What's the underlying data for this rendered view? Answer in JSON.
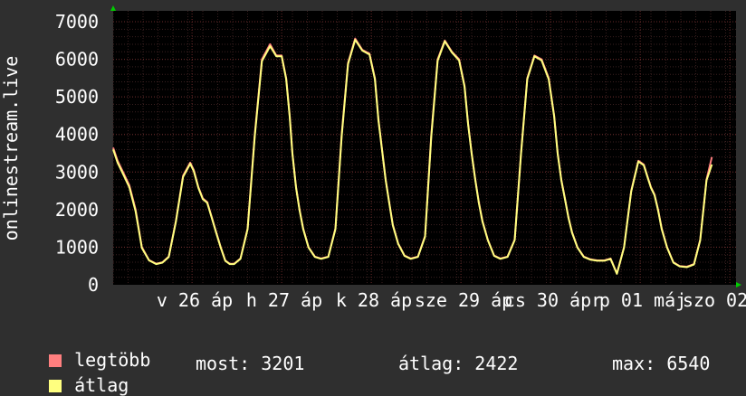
{
  "chart_data": {
    "type": "line",
    "ylabel": "onlinestream.live",
    "ylim": [
      0,
      7000
    ],
    "yticks": [
      0,
      1000,
      2000,
      3000,
      4000,
      5000,
      6000,
      7000
    ],
    "xticks": [
      "v 26 ápr",
      "h 27 ápr",
      "k 28 ápr",
      "sze 29 ápr",
      "cs 30 ápr",
      "p 01 máj",
      "szo 02"
    ],
    "xtick_labels_rendered": [
      "v 26 áp",
      "h 27 áp",
      "k 28 áp",
      "sze 29 áp",
      "cs 30 ápr",
      "p 01 máj",
      "szo 02"
    ],
    "grid": true,
    "colors": {
      "background": "#2f2f2f",
      "plot": "#000000",
      "grid": "#6a2a2a",
      "legtobb": "#ff7f7f",
      "atlag": "#ffff7f",
      "axis_arrow": "#00cc00"
    },
    "x": [
      0.0,
      0.05,
      0.12,
      0.18,
      0.25,
      0.32,
      0.4,
      0.48,
      0.55,
      0.62,
      0.7,
      0.78,
      0.86,
      0.9,
      0.95,
      1.0,
      1.05,
      1.1,
      1.15,
      1.2,
      1.25,
      1.3,
      1.35,
      1.42,
      1.5,
      1.58,
      1.66,
      1.75,
      1.82,
      1.88,
      1.93,
      1.97,
      2.0,
      2.04,
      2.08,
      2.12,
      2.18,
      2.25,
      2.32,
      2.4,
      2.48,
      2.55,
      2.62,
      2.7,
      2.78,
      2.86,
      2.92,
      2.96,
      3.0,
      3.04,
      3.08,
      3.12,
      3.18,
      3.25,
      3.32,
      3.4,
      3.48,
      3.55,
      3.62,
      3.7,
      3.78,
      3.86,
      3.92,
      3.96,
      4.0,
      4.04,
      4.08,
      4.12,
      4.18,
      4.25,
      4.32,
      4.4,
      4.48,
      4.55,
      4.62,
      4.7,
      4.78,
      4.86,
      4.92,
      4.96,
      5.0,
      5.04,
      5.08,
      5.12,
      5.18,
      5.25,
      5.32,
      5.4,
      5.48,
      5.55,
      5.62,
      5.7,
      5.78,
      5.86,
      5.92,
      5.96,
      6.0,
      6.04,
      6.08,
      6.12,
      6.18,
      6.25,
      6.32,
      6.4,
      6.48,
      6.55,
      6.62,
      6.68
    ],
    "series": [
      {
        "name": "legtöbb",
        "values": [
          3650,
          3300,
          2950,
          2650,
          2000,
          1000,
          660,
          560,
          600,
          750,
          1700,
          2900,
          3250,
          3050,
          2600,
          2300,
          2200,
          1800,
          1400,
          1000,
          650,
          560,
          560,
          700,
          1500,
          4000,
          6000,
          6400,
          6100,
          6100,
          5500,
          4500,
          3500,
          2600,
          2000,
          1500,
          1000,
          750,
          700,
          750,
          1500,
          4000,
          5900,
          6550,
          6250,
          6150,
          5500,
          4400,
          3600,
          2800,
          2200,
          1600,
          1100,
          780,
          700,
          750,
          1300,
          4000,
          6000,
          6500,
          6200,
          6000,
          5300,
          4300,
          3500,
          2800,
          2200,
          1700,
          1200,
          780,
          700,
          750,
          1200,
          3500,
          5500,
          6100,
          6000,
          5500,
          4500,
          3500,
          2800,
          2300,
          1800,
          1400,
          1000,
          750,
          680,
          650,
          650,
          700,
          300,
          1000,
          2500,
          3300,
          3200,
          2900,
          2600,
          2400,
          2000,
          1500,
          1000,
          600,
          500,
          480,
          550,
          1200,
          2800,
          3400
        ]
      },
      {
        "name": "átlag",
        "values": [
          3600,
          3250,
          2900,
          2600,
          1950,
          980,
          650,
          550,
          590,
          740,
          1680,
          2870,
          3220,
          3020,
          2580,
          2280,
          2180,
          1780,
          1380,
          990,
          640,
          550,
          550,
          690,
          1480,
          3950,
          5950,
          6350,
          6080,
          6080,
          5470,
          4470,
          3480,
          2580,
          1980,
          1480,
          990,
          740,
          690,
          740,
          1480,
          3950,
          5870,
          6520,
          6230,
          6130,
          5470,
          4380,
          3580,
          2780,
          2180,
          1580,
          1090,
          770,
          690,
          740,
          1280,
          3950,
          5960,
          6480,
          6180,
          5970,
          5270,
          4280,
          3480,
          2780,
          2180,
          1680,
          1190,
          770,
          690,
          740,
          1190,
          3480,
          5470,
          6080,
          5970,
          5470,
          4480,
          3480,
          2780,
          2280,
          1780,
          1380,
          990,
          740,
          670,
          640,
          640,
          690,
          290,
          990,
          2480,
          3280,
          3180,
          2880,
          2580,
          2380,
          1980,
          1480,
          990,
          590,
          490,
          470,
          540,
          1180,
          2780,
          3201
        ]
      }
    ],
    "legend_placement": "bottom-left",
    "legend": [
      "legtöbb",
      "átlag"
    ]
  },
  "stats": {
    "now_label": "most:",
    "now_value": "3201",
    "avg_label": "átlag:",
    "avg_value": "2422",
    "max_label": "max:",
    "max_value": "6540"
  }
}
